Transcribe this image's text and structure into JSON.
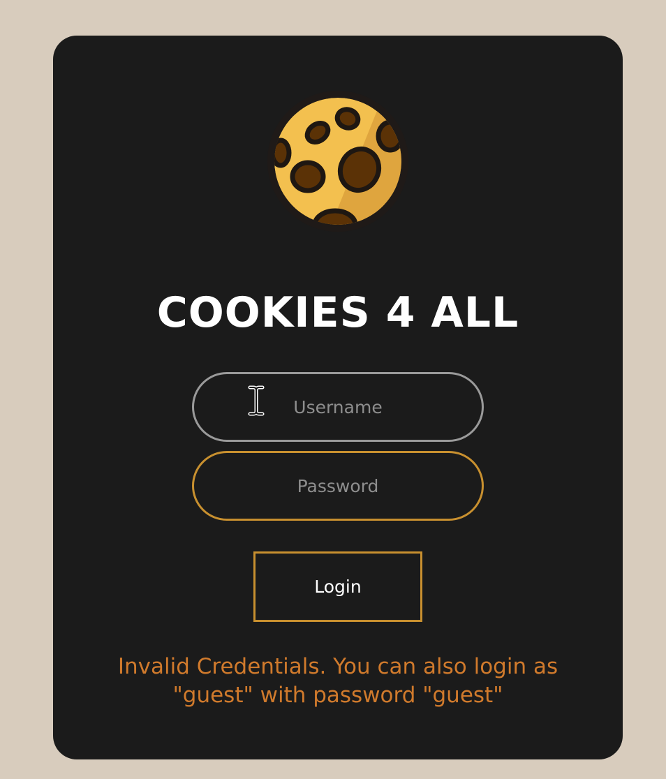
{
  "app": {
    "title": "COOKIES 4 ALL",
    "logo_icon": "cookie-icon"
  },
  "form": {
    "username_placeholder": "Username",
    "username_value": "",
    "password_placeholder": "Password",
    "password_value": "",
    "login_label": "Login"
  },
  "message": {
    "error_text": "Invalid Credentials. You can also login as\n\"guest\" with password \"guest\""
  },
  "colors": {
    "page_background": "#d8ccbd",
    "card_background": "#1b1b1b",
    "accent": "#c8902f",
    "error": "#d07a2c",
    "title": "#ffffff"
  }
}
